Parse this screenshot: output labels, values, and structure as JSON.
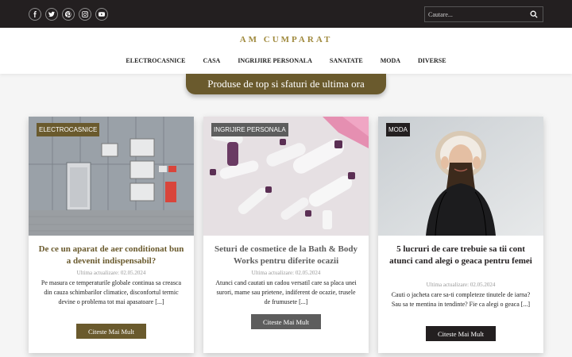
{
  "social": [
    "facebook-icon",
    "twitter-icon",
    "pinterest-icon",
    "instagram-icon",
    "youtube-icon"
  ],
  "search": {
    "placeholder": "Cautare..."
  },
  "logo": "AM CUMPARAT",
  "nav": [
    "ELECTROCASNICE",
    "CASA",
    "INGRIJIRE PERSONALA",
    "SANATATE",
    "MODA",
    "DIVERSE"
  ],
  "banner": "Produse de top si sfaturi de ultima ora",
  "cards": [
    {
      "category": "ELECTROCASNICE",
      "title": "De ce un aparat de aer conditionat bun a devenit indispensabil?",
      "date": "Ultima actualizare: 02.05.2024",
      "excerpt": "Pe masura ce temperaturile globale continua sa creasca din cauza schimbarilor climatice, disconfortul termic devine o problema tot mai apasatoare [...]",
      "button": "Citeste Mai Mult",
      "accent": "#6a5a2d"
    },
    {
      "category": "INGRIJIRE PERSONALA",
      "title": "Seturi de cosmetice de la Bath & Body Works pentru diferite ocazii",
      "date": "Ultima actualizare: 02.05.2024",
      "excerpt": "Atunci cand cautati un cadou versatil care sa placa unei surori, mame sau prietene, indiferent de ocazie, trusele de frumusete [...]",
      "button": "Citeste Mai Mult",
      "accent": "#5d5d5d"
    },
    {
      "category": "MODA",
      "title": "5 lucruri de care trebuie sa tii cont atunci cand alegi o geaca pentru femei",
      "date": "Ultima actualizare: 02.05.2024",
      "excerpt": "Cauti o jacheta care sa-ti completeze tinutele de iarna? Sau sa te mentina in tendinte? Fie ca alegi o geaca [...]",
      "button": "Citeste Mai Mult",
      "accent": "#231f20"
    }
  ]
}
